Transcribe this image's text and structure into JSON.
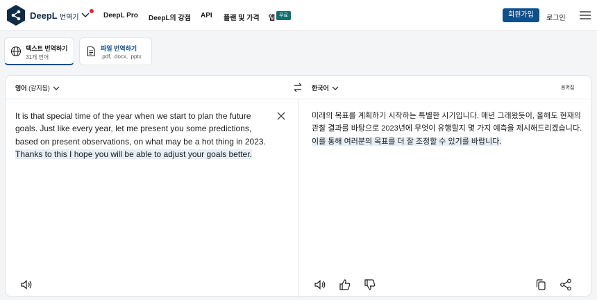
{
  "header": {
    "brand": "DeepL",
    "brand_sub": "번역기",
    "nav": [
      "DeepL Pro",
      "DeepL의 강점",
      "API",
      "플랜 및 가격",
      "앱"
    ],
    "app_badge": "무료",
    "signup": "회원가입",
    "login": "로그인"
  },
  "modes": [
    {
      "title": "텍스트 번역하기",
      "sub": "31개 언어"
    },
    {
      "title": "파일 번역하기",
      "sub": ".pdf, .docx, .pptx"
    }
  ],
  "translator": {
    "source_lang": "영어",
    "source_detected": "(감지됨)",
    "target_lang": "한국어",
    "glossary": "용어집",
    "source_text_plain": "It is that special time of the year when we start to plan the future goals. Just like every year, let me present you some predictions, based on present observations, on what may be a hot thing in 2023. ",
    "source_text_highlight": "Thanks to this I hope you will be able to adjust your goals better.",
    "target_text_plain": "미래의 목표를 계획하기 시작하는 특별한 시기입니다. 매년 그래왔듯이, 올해도 현재의 관찰 결과를 바탕으로 2023년에 무엇이 유행할지 몇 가지 예측을 제시해드리겠습니다. ",
    "target_text_highlight": "이를 통해 여러분의 목표를 더 잘 조정할 수 있기를 바랍니다."
  },
  "colors": {
    "accent": "#0f4f8a",
    "brand_dark": "#0f2b46",
    "badge": "#0f6e6e",
    "highlight": "#e6eef6",
    "notification_dot": "#e0282e"
  },
  "icons": [
    "deepl-logo-icon",
    "chevron-down-icon",
    "hamburger-menu-icon",
    "globe-icon",
    "document-icon",
    "swap-icon",
    "close-icon",
    "speaker-icon",
    "thumbs-up-icon",
    "thumbs-down-icon",
    "copy-icon",
    "share-icon"
  ]
}
